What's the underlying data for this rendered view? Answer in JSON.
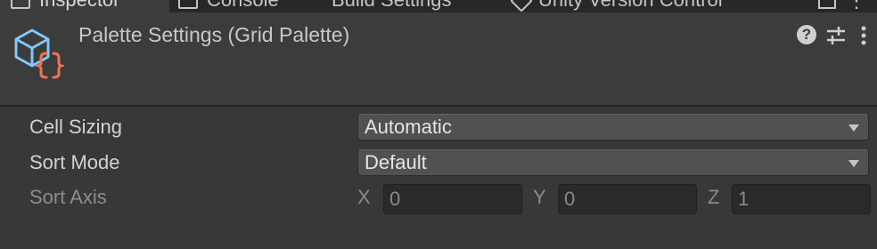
{
  "tabs": [
    {
      "label": "Inspector",
      "icon": "inspector-icon"
    },
    {
      "label": "Console",
      "icon": "console-icon"
    },
    {
      "label": "Build Settings",
      "icon": ""
    },
    {
      "label": "Unity Version Control",
      "icon": "unity-version-control-icon"
    }
  ],
  "header": {
    "title": "Palette Settings (Grid Palette)",
    "icon": "scriptable-object-icon",
    "help_glyph": "?",
    "accent_colors": {
      "cube": "#7fc8ff",
      "braces": "#f07352"
    }
  },
  "properties": {
    "cell_sizing": {
      "label": "Cell Sizing",
      "value": "Automatic"
    },
    "sort_mode": {
      "label": "Sort Mode",
      "value": "Default"
    },
    "sort_axis": {
      "label": "Sort Axis",
      "x_label": "X",
      "x_value": "0",
      "y_label": "Y",
      "y_value": "0",
      "z_label": "Z",
      "z_value": "1",
      "disabled": true
    }
  }
}
